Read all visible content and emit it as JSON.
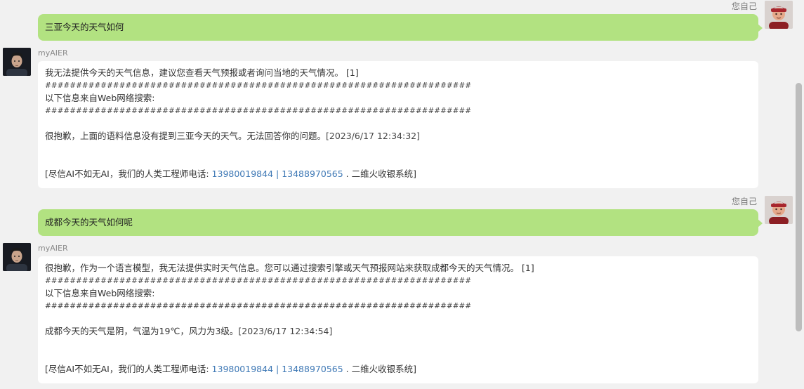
{
  "conversation": [
    {
      "user": {
        "name": "您自己",
        "message": "三亚今天的天气如何"
      },
      "bot": {
        "name": "myAIER",
        "reply": "我无法提供今天的天气信息，建议您查看天气预报或者询问当地的天气情况。",
        "ref": "[1]",
        "separator": "#####################################################################",
        "web_label": "以下信息来自Web网络搜索:",
        "web_result": "很抱歉，上面的语料信息没有提到三亚今天的天气。无法回答你的问题。",
        "timestamp": "[2023/6/17 12:34:32]",
        "footer_prefix": "[尽信AI不如无AI，我们的人类工程师电话: ",
        "phone1": "13980019844",
        "phone_sep": " | ",
        "phone2": "13488970565",
        "footer_suffix": " . 二维火收银系统]"
      }
    },
    {
      "user": {
        "name": "您自己",
        "message": "成都今天的天气如何呢"
      },
      "bot": {
        "name": "myAIER",
        "reply": "很抱歉，作为一个语言模型，我无法提供实时天气信息。您可以通过搜索引擎或天气预报网站来获取成都今天的天气情况。",
        "ref": "[1]",
        "separator": "#####################################################################",
        "web_label": "以下信息来自Web网络搜索:",
        "web_result": "成都今天的天气是阴，气温为19℃，风力为3级。",
        "timestamp": "[2023/6/17 12:34:54]",
        "footer_prefix": "[尽信AI不如无AI，我们的人类工程师电话: ",
        "phone1": "13980019844",
        "phone_sep": " | ",
        "phone2": "13488970565",
        "footer_suffix": " . 二维火收银系统]"
      }
    }
  ],
  "colors": {
    "background": "#f1f1f1",
    "user_bubble": "#b2e281",
    "bot_bubble": "#ffffff",
    "link": "#3e78b5"
  },
  "icons": {
    "user_avatar": "user-avatar-icon",
    "bot_avatar": "bot-avatar-icon"
  }
}
